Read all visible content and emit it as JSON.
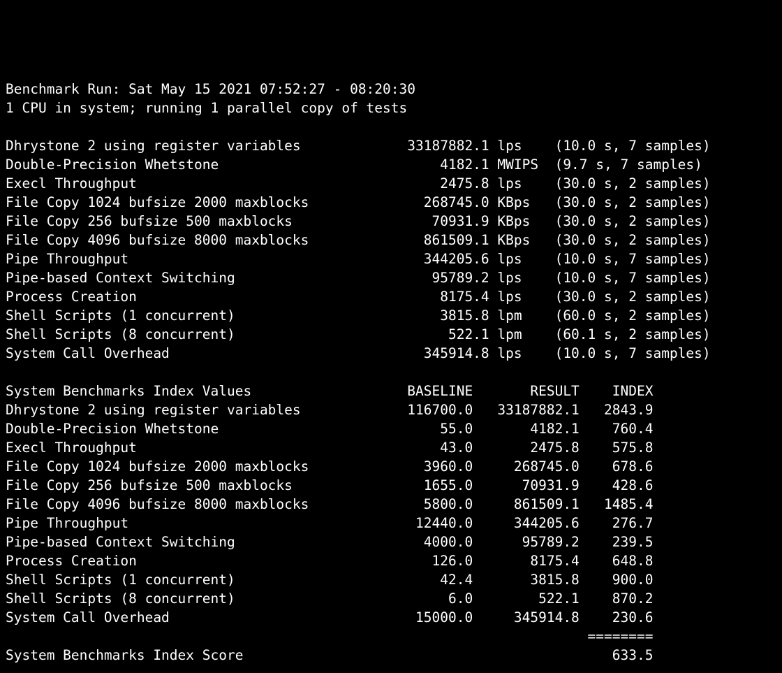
{
  "header": {
    "line1": "Benchmark Run: Sat May 15 2021 07:52:27 - 08:20:30",
    "line2": "1 CPU in system; running 1 parallel copy of tests"
  },
  "tests": [
    {
      "name": "Dhrystone 2 using register variables",
      "value": "33187882.1",
      "unit": "lps",
      "timing": "(10.0 s, 7 samples)"
    },
    {
      "name": "Double-Precision Whetstone",
      "value": "4182.1",
      "unit": "MWIPS",
      "timing": "(9.7 s, 7 samples)"
    },
    {
      "name": "Execl Throughput",
      "value": "2475.8",
      "unit": "lps",
      "timing": "(30.0 s, 2 samples)"
    },
    {
      "name": "File Copy 1024 bufsize 2000 maxblocks",
      "value": "268745.0",
      "unit": "KBps",
      "timing": "(30.0 s, 2 samples)"
    },
    {
      "name": "File Copy 256 bufsize 500 maxblocks",
      "value": "70931.9",
      "unit": "KBps",
      "timing": "(30.0 s, 2 samples)"
    },
    {
      "name": "File Copy 4096 bufsize 8000 maxblocks",
      "value": "861509.1",
      "unit": "KBps",
      "timing": "(30.0 s, 2 samples)"
    },
    {
      "name": "Pipe Throughput",
      "value": "344205.6",
      "unit": "lps",
      "timing": "(10.0 s, 7 samples)"
    },
    {
      "name": "Pipe-based Context Switching",
      "value": "95789.2",
      "unit": "lps",
      "timing": "(10.0 s, 7 samples)"
    },
    {
      "name": "Process Creation",
      "value": "8175.4",
      "unit": "lps",
      "timing": "(30.0 s, 2 samples)"
    },
    {
      "name": "Shell Scripts (1 concurrent)",
      "value": "3815.8",
      "unit": "lpm",
      "timing": "(60.0 s, 2 samples)"
    },
    {
      "name": "Shell Scripts (8 concurrent)",
      "value": "522.1",
      "unit": "lpm",
      "timing": "(60.1 s, 2 samples)"
    },
    {
      "name": "System Call Overhead",
      "value": "345914.8",
      "unit": "lps",
      "timing": "(10.0 s, 7 samples)"
    }
  ],
  "index_header": {
    "title": "System Benchmarks Index Values",
    "col_baseline": "BASELINE",
    "col_result": "RESULT",
    "col_index": "INDEX"
  },
  "index_rows": [
    {
      "name": "Dhrystone 2 using register variables",
      "baseline": "116700.0",
      "result": "33187882.1",
      "index": "2843.9"
    },
    {
      "name": "Double-Precision Whetstone",
      "baseline": "55.0",
      "result": "4182.1",
      "index": "760.4"
    },
    {
      "name": "Execl Throughput",
      "baseline": "43.0",
      "result": "2475.8",
      "index": "575.8"
    },
    {
      "name": "File Copy 1024 bufsize 2000 maxblocks",
      "baseline": "3960.0",
      "result": "268745.0",
      "index": "678.6"
    },
    {
      "name": "File Copy 256 bufsize 500 maxblocks",
      "baseline": "1655.0",
      "result": "70931.9",
      "index": "428.6"
    },
    {
      "name": "File Copy 4096 bufsize 8000 maxblocks",
      "baseline": "5800.0",
      "result": "861509.1",
      "index": "1485.4"
    },
    {
      "name": "Pipe Throughput",
      "baseline": "12440.0",
      "result": "344205.6",
      "index": "276.7"
    },
    {
      "name": "Pipe-based Context Switching",
      "baseline": "4000.0",
      "result": "95789.2",
      "index": "239.5"
    },
    {
      "name": "Process Creation",
      "baseline": "126.0",
      "result": "8175.4",
      "index": "648.8"
    },
    {
      "name": "Shell Scripts (1 concurrent)",
      "baseline": "42.4",
      "result": "3815.8",
      "index": "900.0"
    },
    {
      "name": "Shell Scripts (8 concurrent)",
      "baseline": "6.0",
      "result": "522.1",
      "index": "870.2"
    },
    {
      "name": "System Call Overhead",
      "baseline": "15000.0",
      "result": "345914.8",
      "index": "230.6"
    }
  ],
  "score": {
    "separator": "========",
    "label": "System Benchmarks Index Score",
    "value": "633.5"
  },
  "cols": {
    "test_name_width": 41,
    "test_value_width": 18,
    "test_unit_width": 6,
    "index_name_width": 41,
    "baseline_width": 16,
    "result_width": 13,
    "index_width": 9
  }
}
